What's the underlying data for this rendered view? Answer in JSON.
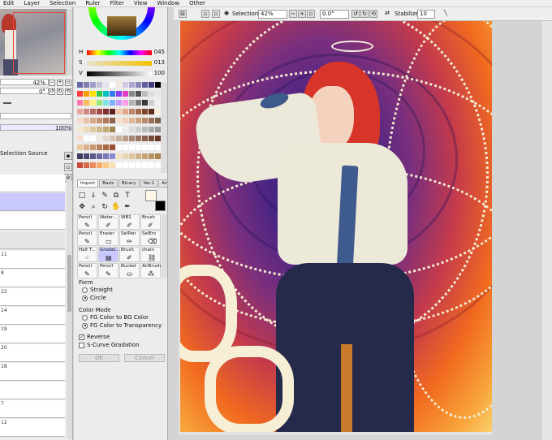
{
  "menu": [
    "Edit",
    "Layer",
    "Selection",
    "Ruler",
    "Filter",
    "View",
    "Window",
    "Other"
  ],
  "navigator": {
    "zoom": "42%",
    "angle": "0°",
    "opacity": "100%"
  },
  "selection_source_label": "Selection Source",
  "layers": [
    "",
    "",
    "",
    "",
    "11",
    "8",
    "22",
    "14",
    "19",
    "20",
    "18",
    "",
    "7",
    "12"
  ],
  "color": {
    "h_label": "H",
    "h_value": "045",
    "s_label": "S",
    "s_value": "013",
    "v_label": "V",
    "v_value": "100",
    "fg": "#fff8e8",
    "bg": "#000000"
  },
  "tool_tabs": [
    "Import",
    "Basic",
    "Binary",
    "Ver.1",
    "Artistic"
  ],
  "brushes": [
    {
      "label": "Pencil",
      "icon": "pencil-icon"
    },
    {
      "label": "Water...",
      "icon": "brush-icon"
    },
    {
      "label": "WB1",
      "icon": "brush-icon"
    },
    {
      "label": "Brush",
      "icon": "brush-icon"
    },
    {
      "label": "Pencil",
      "icon": "pencil-icon"
    },
    {
      "label": "Eraser",
      "icon": "eraser-icon"
    },
    {
      "label": "SelPen",
      "icon": "selpen-icon"
    },
    {
      "label": "SelErs",
      "icon": "selers-icon"
    },
    {
      "label": "Half T...",
      "icon": "halftone-icon"
    },
    {
      "label": "Gradat...",
      "icon": "gradation-icon"
    },
    {
      "label": "Brush",
      "icon": "brush-icon"
    },
    {
      "label": "chain",
      "icon": "chain-icon"
    },
    {
      "label": "Pencil",
      "icon": "pencil-icon"
    },
    {
      "label": "Pencil",
      "icon": "pencil-icon"
    },
    {
      "label": "Bucket",
      "icon": "bucket-icon"
    },
    {
      "label": "AirBrush",
      "icon": "airbrush-icon"
    }
  ],
  "form": {
    "label": "Form",
    "options": [
      "Straight",
      "Circle"
    ],
    "selected": "Circle"
  },
  "color_mode": {
    "label": "Color Mode",
    "options": [
      "FG Color to BG Color",
      "FG Color to Transparency"
    ],
    "selected": "FG Color to Transparency"
  },
  "checks": {
    "reverse_label": "Reverse",
    "reverse_checked": true,
    "scurve_label": "S-Curve Gradation",
    "scurve_checked": false
  },
  "buttons": {
    "ok": "OK",
    "cancel": "Cancel"
  },
  "toolbar": {
    "selection_label": "Selection",
    "zoom": "42%",
    "angle": "0.0°",
    "stabilizer_label": "Stabilizer",
    "stabilizer_value": "10"
  }
}
